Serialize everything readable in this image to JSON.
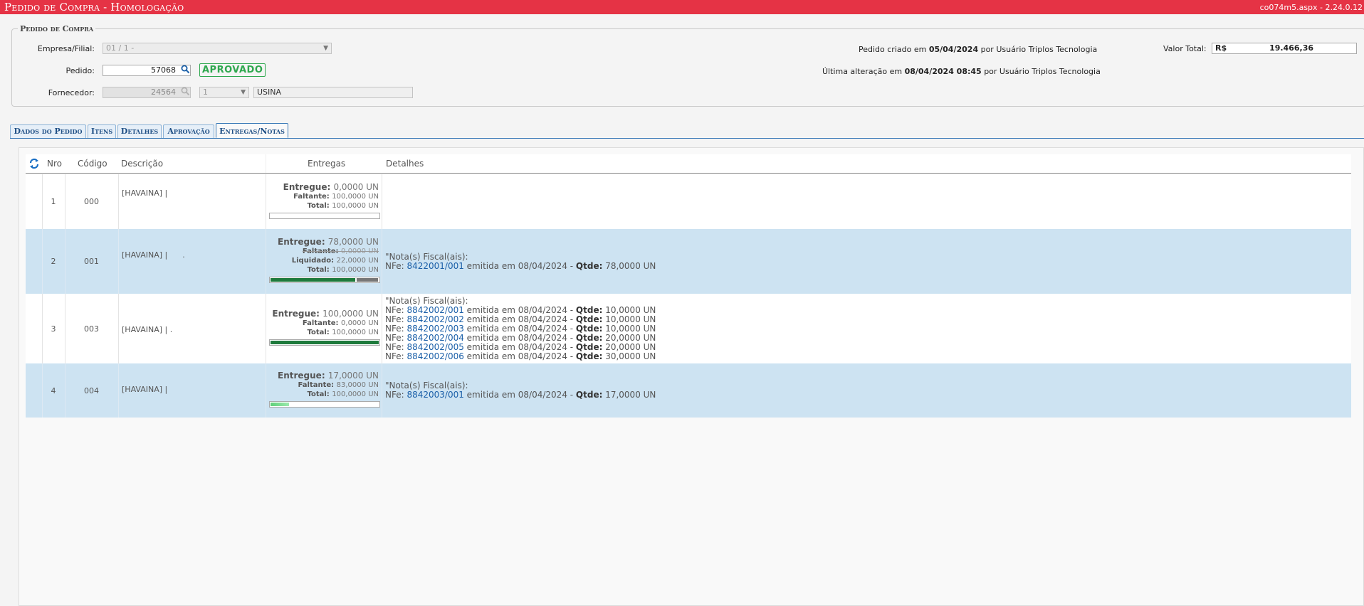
{
  "window": {
    "title": "Pedido de Compra  - Homologação",
    "version": "co074m5.aspx - 2.24.0.12"
  },
  "header": {
    "legend": "Pedido de Compra",
    "empresa_label": "Empresa/Filial:",
    "empresa_value": "01 / 1 -",
    "pedido_label": "Pedido:",
    "pedido_value": "57068",
    "status": "APROVADO",
    "fornecedor_label": "Fornecedor:",
    "fornecedor_code": "24564",
    "fornecedor_seq": "1",
    "fornecedor_name": "USINA",
    "created_prefix": "Pedido criado em",
    "created_date": "05/04/2024",
    "created_by": "por Usuário Triplos Tecnologia",
    "altered_prefix": "Última alteração em",
    "altered_date": "08/04/2024 08:45",
    "altered_by": "por Usuário Triplos Tecnologia",
    "valor_label": "Valor Total:",
    "valor_currency": "R$",
    "valor_value": "19.466,36"
  },
  "tabs": [
    {
      "label": "Dados do Pedido"
    },
    {
      "label": "Itens"
    },
    {
      "label": "Detalhes"
    },
    {
      "label": "Aprovação"
    },
    {
      "label": "Entregas/Notas"
    }
  ],
  "grid": {
    "columns": {
      "nro": "Nro",
      "codigo": "Código",
      "descricao": "Descrição",
      "entregas": "Entregas",
      "detalhes": "Detalhes"
    },
    "rows": [
      {
        "nro": "1",
        "codigo": "000",
        "descricao": "[HAVAINA] |",
        "entregue_label": "Entregue:",
        "entregue": "0,0000 UN",
        "faltante_label": "Faltante:",
        "faltante": "100,0000 UN",
        "total_label": "Total:",
        "total": "100,0000 UN",
        "progress": 0,
        "notas_header": "",
        "notas": []
      },
      {
        "nro": "2",
        "codigo": "001",
        "descricao": "[HAVAINA] |      .",
        "entregue_label": "Entregue:",
        "entregue": "78,0000 UN",
        "faltante_label": "Faltante:",
        "faltante": "0,0000 UN",
        "liquidado_label": "Liquidado:",
        "liquidado": "22,0000 UN",
        "total_label": "Total:",
        "total": "100,0000 UN",
        "progress": 0.78,
        "liquidado_fraction": 0.22,
        "notas_header": "\"Nota(s) Fiscal(ais):",
        "notas": [
          {
            "num": "8422001/001",
            "date": "08/04/2024",
            "qtde": "78,0000 UN"
          }
        ]
      },
      {
        "nro": "3",
        "codigo": "003",
        "descricao": "[HAVAINA] | .",
        "entregue_label": "Entregue:",
        "entregue": "100,0000 UN",
        "faltante_label": "Faltante:",
        "faltante": "0,0000 UN",
        "total_label": "Total:",
        "total": "100,0000 UN",
        "progress": 1,
        "notas_header": "\"Nota(s) Fiscal(ais):",
        "notas": [
          {
            "num": "8842002/001",
            "date": "08/04/2024",
            "qtde": "10,0000 UN"
          },
          {
            "num": "8842002/002",
            "date": "08/04/2024",
            "qtde": "10,0000 UN"
          },
          {
            "num": "8842002/003",
            "date": "08/04/2024",
            "qtde": "10,0000 UN"
          },
          {
            "num": "8842002/004",
            "date": "08/04/2024",
            "qtde": "20,0000 UN"
          },
          {
            "num": "8842002/005",
            "date": "08/04/2024",
            "qtde": "20,0000 UN"
          },
          {
            "num": "8842002/006",
            "date": "08/04/2024",
            "qtde": "30,0000 UN"
          }
        ]
      },
      {
        "nro": "4",
        "codigo": "004",
        "descricao": "[HAVAINA] |",
        "entregue_label": "Entregue:",
        "entregue": "17,0000 UN",
        "faltante_label": "Faltante:",
        "faltante": "83,0000 UN",
        "total_label": "Total:",
        "total": "100,0000 UN",
        "progress": 0.17,
        "notas_header": "\"Nota(s) Fiscal(ais):",
        "notas": [
          {
            "num": "8842003/001",
            "date": "08/04/2024",
            "qtde": "17,0000 UN"
          }
        ]
      }
    ],
    "nfe_prefix": "NFe:",
    "emitida_word": "emitida em",
    "qtde_label": "Qtde:"
  },
  "colors": {
    "titlebar": "#e53345",
    "approved": "#2fa84f",
    "row_alt": "#cde3f2",
    "link": "#1a5fa8",
    "bar_full": "#1e7a3c",
    "bar_liquidado": "#777777"
  }
}
